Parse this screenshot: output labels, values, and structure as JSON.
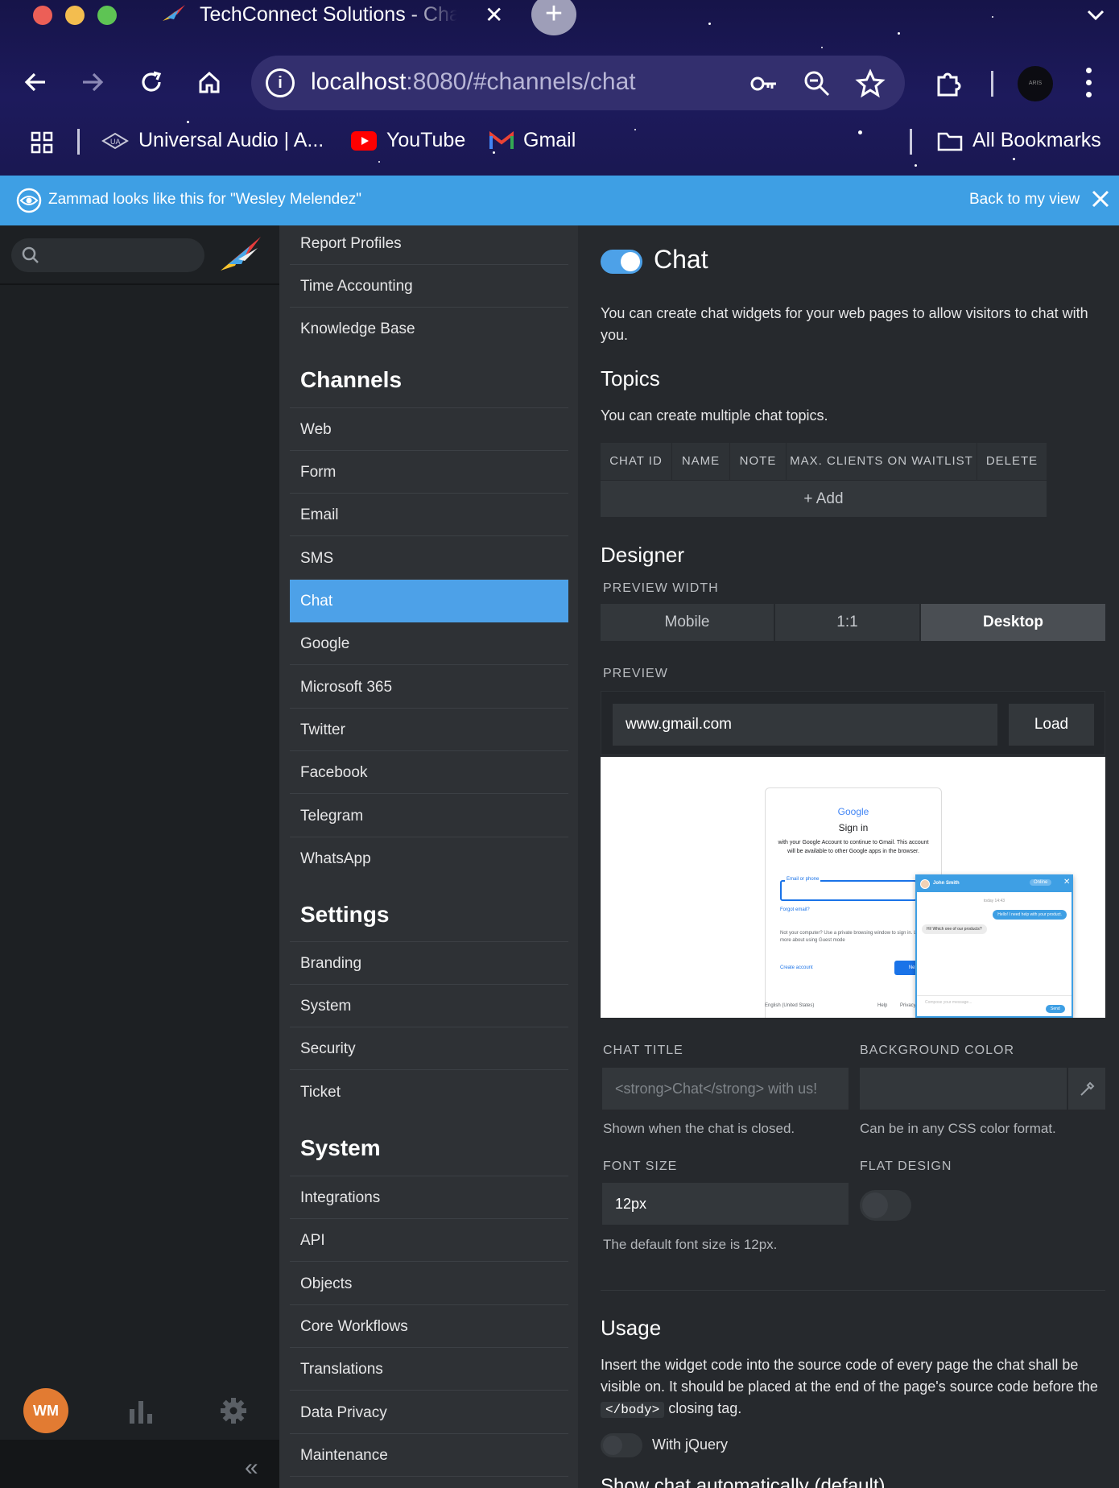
{
  "browser": {
    "tab_title": "TechConnect Solutions - Chat",
    "url_host": "localhost",
    "url_path": ":8080/#channels/chat",
    "bookmarks": [
      {
        "label": "Universal Audio | A..."
      },
      {
        "label": "YouTube"
      },
      {
        "label": "Gmail"
      }
    ],
    "all_bookmarks": "All Bookmarks",
    "profile_text": "ARIS"
  },
  "banner": {
    "text": "Zammad looks like this for \"Wesley Melendez\"",
    "back_label": "Back to my view"
  },
  "appnav": {
    "avatar_initials": "WM",
    "collapse_glyph": "«"
  },
  "menu": {
    "top_items": [
      "Report Profiles",
      "Time Accounting",
      "Knowledge Base"
    ],
    "channels_heading": "Channels",
    "channels": [
      "Web",
      "Form",
      "Email",
      "SMS",
      "Chat",
      "Google",
      "Microsoft 365",
      "Twitter",
      "Facebook",
      "Telegram",
      "WhatsApp"
    ],
    "active": "Chat",
    "settings_heading": "Settings",
    "settings": [
      "Branding",
      "System",
      "Security",
      "Ticket"
    ],
    "system_heading": "System",
    "system": [
      "Integrations",
      "API",
      "Objects",
      "Core Workflows",
      "Translations",
      "Data Privacy",
      "Maintenance"
    ]
  },
  "main": {
    "title": "Chat",
    "enabled": true,
    "intro": "You can create chat widgets for your web pages to allow visitors to chat with you.",
    "topics_heading": "Topics",
    "topics_text": "You can create multiple chat topics.",
    "topics_columns": [
      "CHAT ID",
      "NAME",
      "NOTE",
      "MAX. CLIENTS ON WAITLIST",
      "DELETE"
    ],
    "topics_add": "+ Add",
    "designer_heading": "Designer",
    "preview_width_label": "PREVIEW WIDTH",
    "preview_widths": [
      "Mobile",
      "1:1",
      "Desktop"
    ],
    "preview_width_selected": "Desktop",
    "preview_label": "PREVIEW",
    "preview_url": "www.gmail.com",
    "load_label": "Load",
    "google_preview": {
      "logo": "Google",
      "heading": "Sign in",
      "sub": "with your Google Account to continue to Gmail. This account will be available to other Google apps in the browser.",
      "email_label": "Email or phone",
      "forgot": "Forgot email?",
      "guest": "Not your computer? Use a private browsing window to sign in. Learn more about using Guest mode",
      "create": "Create account",
      "next": "Next",
      "lang": "English (United States)",
      "help": "Help",
      "privacy": "Privacy"
    },
    "chat_widget": {
      "agent": "John Smith",
      "status": "Online",
      "time": "today 14:43",
      "msg_visitor": "Hello! I need help with your product.",
      "msg_agent": "Hi! Which one of our products?",
      "input_placeholder": "Compose your message...",
      "send": "Send"
    },
    "chat_title_label": "CHAT TITLE",
    "chat_title_placeholder": "<strong>Chat</strong> with us!",
    "chat_title_help": "Shown when the chat is closed.",
    "bg_color_label": "BACKGROUND COLOR",
    "bg_color_help": "Can be in any CSS color format.",
    "font_size_label": "FONT SIZE",
    "font_size_value": "12px",
    "font_size_help": "The default font size is 12px.",
    "flat_design_label": "FLAT DESIGN",
    "flat_design": false,
    "usage_heading": "Usage",
    "usage_text_1": "Insert the widget code into the source code of every page the chat shall be visible on. It should be placed at the end of the page's source code before the",
    "usage_code": "</body>",
    "usage_text_2": "closing tag.",
    "with_jquery_label": "With jQuery",
    "with_jquery": false,
    "show_auto_label": "Show chat automatically (default)"
  },
  "colors": {
    "accent": "#4da1e8",
    "banner": "#3e9fe4",
    "avatar": "#e27b32"
  }
}
